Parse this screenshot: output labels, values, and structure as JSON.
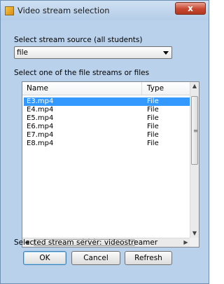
{
  "window": {
    "title": "Video stream selection",
    "close_glyph": "x"
  },
  "source": {
    "label": "Select stream source (all students)",
    "selected": "file"
  },
  "streams": {
    "label": "Select one of the file streams or files",
    "columns": {
      "name": "Name",
      "type": "Type"
    },
    "rows": [
      {
        "name": "E3.mp4",
        "type": "File",
        "selected": true
      },
      {
        "name": "E4.mp4",
        "type": "File",
        "selected": false
      },
      {
        "name": "E5.mp4",
        "type": "File",
        "selected": false
      },
      {
        "name": "E6.mp4",
        "type": "File",
        "selected": false
      },
      {
        "name": "E7.mp4",
        "type": "File",
        "selected": false
      },
      {
        "name": "E8.mp4",
        "type": "File",
        "selected": false
      }
    ]
  },
  "status": {
    "text": "Selected stream server:  videostreamer"
  },
  "buttons": {
    "ok": "OK",
    "cancel": "Cancel",
    "refresh": "Refresh"
  }
}
